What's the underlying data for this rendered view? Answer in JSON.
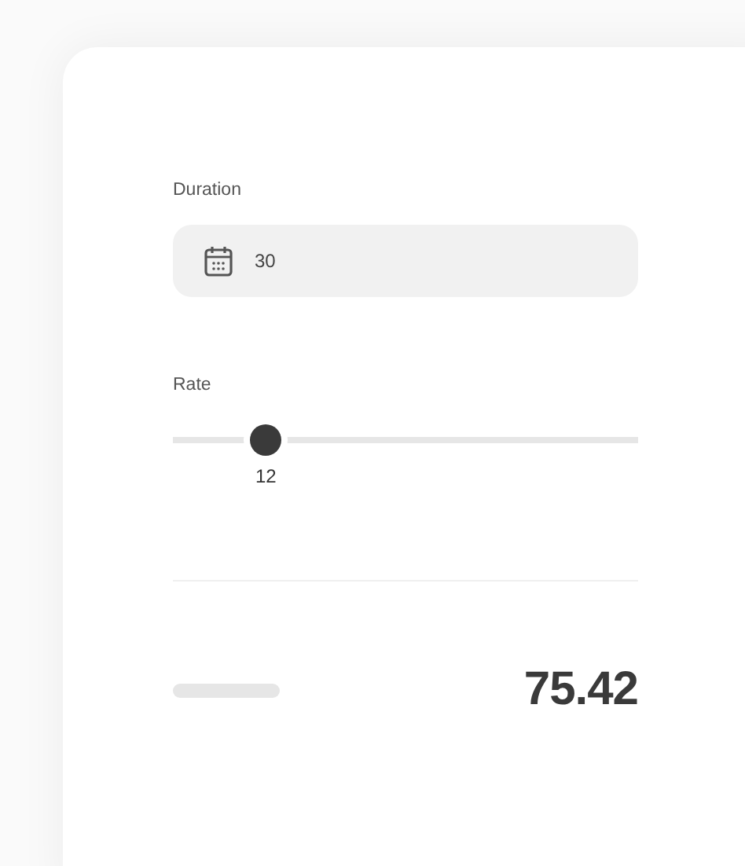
{
  "duration": {
    "label": "Duration",
    "value": "30"
  },
  "rate": {
    "label": "Rate",
    "level": 0.2,
    "reading": "12"
  },
  "total": {
    "value": "75.42"
  }
}
